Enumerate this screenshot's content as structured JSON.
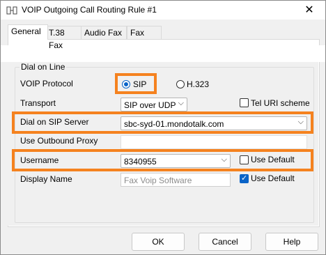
{
  "window": {
    "title": "VOIP Outgoing Call Routing Rule #1",
    "close_glyph": "✕"
  },
  "tabs": [
    {
      "label": "General",
      "active": true
    },
    {
      "label": "T.38 Fax"
    },
    {
      "label": "Audio Fax"
    },
    {
      "label": "Fax"
    }
  ],
  "group": {
    "label": "Dial on Line"
  },
  "voip_protocol": {
    "label": "VOIP Protocol",
    "options": [
      "SIP",
      "H.323"
    ],
    "selected": "SIP"
  },
  "transport": {
    "label": "Transport",
    "value": "SIP over UDP",
    "tel_uri_label": "Tel URI scheme",
    "tel_uri_checked": false
  },
  "dial_server": {
    "label": "Dial on SIP Server",
    "value": "sbc-syd-01.mondotalk.com"
  },
  "outbound_proxy": {
    "label": "Use Outbound Proxy",
    "value": ""
  },
  "username": {
    "label": "Username",
    "value": "8340955",
    "use_default_label": "Use Default",
    "use_default_checked": false
  },
  "display_name": {
    "label": "Display Name",
    "placeholder": "Fax Voip Software",
    "use_default_label": "Use Default",
    "use_default_checked": true
  },
  "buttons": {
    "ok": "OK",
    "cancel": "Cancel",
    "help": "Help"
  },
  "colors": {
    "highlight": "#f5821f",
    "accent": "#0a64c8"
  }
}
